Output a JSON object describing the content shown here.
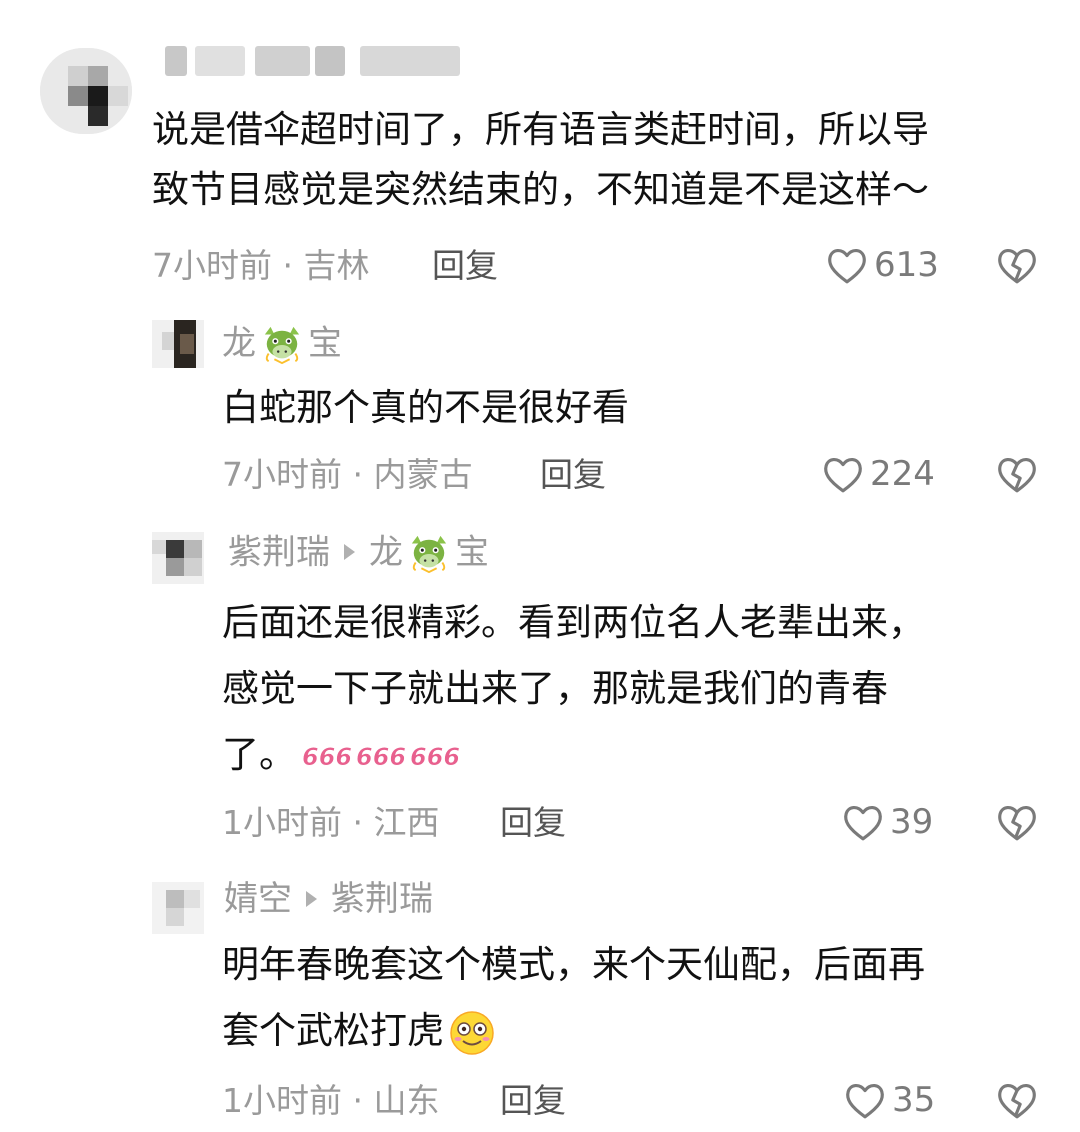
{
  "comments": [
    {
      "username": "",
      "text_lines": [
        "说是借伞超时间了，所有语言类赶时间，所以导",
        "致节目感觉是突然结束的，不知道是不是这样～"
      ],
      "time_location": "7小时前 · 吉林",
      "reply_label": "回复",
      "likes": "613"
    },
    {
      "username_left": "龙",
      "username_right": "宝",
      "username_emoji": "dragon-emoji",
      "text_lines": [
        "白蛇那个真的不是很好看"
      ],
      "time_location": "7小时前 · 内蒙古",
      "reply_label": "回复",
      "likes": "224"
    },
    {
      "username": "紫荆瑞",
      "reply_to_left": "龙",
      "reply_to_right": "宝",
      "reply_to_emoji": "dragon-emoji",
      "text_lines": [
        "后面还是很精彩。看到两位名人老辈出来，",
        "感觉一下子就出来了，那就是我们的青春",
        "了。"
      ],
      "text_emoji": "666-emoji",
      "time_location": "1小时前 · 江西",
      "reply_label": "回复",
      "likes": "39"
    },
    {
      "username": "婧空",
      "reply_to": "紫荆瑞",
      "text_lines": [
        "明年春晚套这个模式，来个天仙配，后面再",
        "套个武松打虎"
      ],
      "text_emoji": "smile-emoji",
      "time_location": "1小时前 · 山东",
      "reply_label": "回复",
      "likes": "35"
    }
  ],
  "colors": {
    "text": "#111111",
    "meta": "#9a9a9a",
    "reply": "#555555",
    "icon": "#7a7a7a",
    "six_pink": "#e8608e"
  }
}
